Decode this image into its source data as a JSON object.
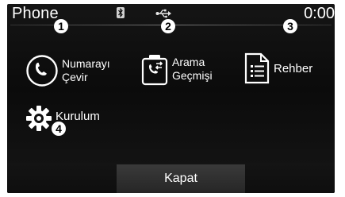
{
  "header": {
    "title": "Phone",
    "clock": "0:00",
    "bluetooth_icon": "bluetooth-icon",
    "usb_icon": "usb-icon"
  },
  "callouts": [
    "1",
    "2",
    "3",
    "4"
  ],
  "menu": {
    "dial": {
      "label_line1": "Numarayı",
      "label_line2": "Çevir",
      "icon": "phone-handset-icon"
    },
    "call_history": {
      "label_line1": "Arama",
      "label_line2": "Geçmişi",
      "icon": "call-history-icon"
    },
    "phonebook": {
      "label": "Rehber",
      "icon": "phonebook-icon"
    },
    "setup": {
      "label": "Kurulum",
      "icon": "gear-icon"
    }
  },
  "footer": {
    "close_label": "Kapat"
  },
  "colors": {
    "background": "#0f0f0f",
    "text": "#ffffff",
    "button": "#303030"
  }
}
